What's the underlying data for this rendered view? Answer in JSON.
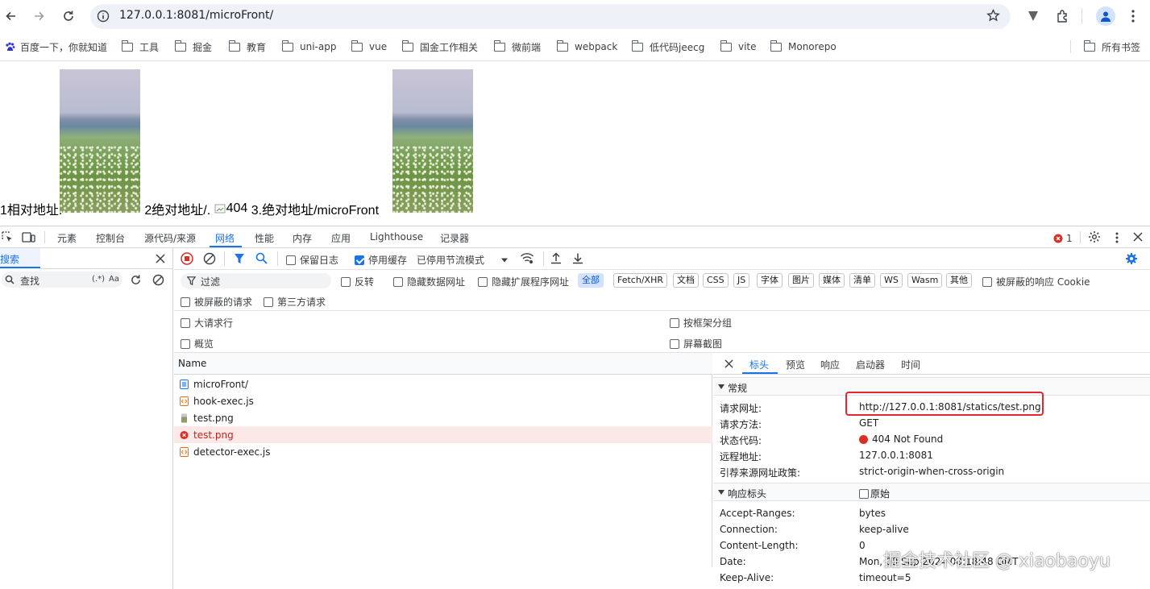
{
  "browser": {
    "url": "127.0.0.1:8081/microFront/",
    "bookmarks": [
      "百度一下，你就知道",
      "工具",
      "掘金",
      "教育",
      "uni-app",
      "vue",
      "国金工作相关",
      "微前端",
      "webpack",
      "低代码jeecg",
      "vite",
      "Monorepo"
    ],
    "all_bookmarks_label": "所有书签"
  },
  "page": {
    "text1": "1相对地址.",
    "text2": "2绝对地址/.",
    "broken_img_alt": "404",
    "text3": "3.绝对地址/microFront"
  },
  "devtools": {
    "tabs": [
      "元素",
      "控制台",
      "源代码/来源",
      "网络",
      "性能",
      "内存",
      "应用",
      "Lighthouse",
      "记录器"
    ],
    "active_tab": "网络",
    "error_count": "1",
    "left_panel": {
      "title": "搜索",
      "search_placeholder": "查找",
      "regex_label": "(.*)",
      "case_label": "Aa"
    },
    "toolbar": {
      "preserve_log": "保留日志",
      "disable_cache": "停用缓存",
      "throttle": "已停用节流模式"
    },
    "filter": {
      "placeholder": "过滤",
      "invert": "反转",
      "hide_data_urls": "隐藏数据网址",
      "hide_extension_urls": "隐藏扩展程序网址",
      "types": [
        "全部",
        "Fetch/XHR",
        "文档",
        "CSS",
        "JS",
        "字体",
        "图片",
        "媒体",
        "清单",
        "WS",
        "Wasm",
        "其他"
      ],
      "active_type": "全部",
      "blocked_cookies": "被屏蔽的响应 Cookie",
      "blocked_requests": "被屏蔽的请求",
      "third_party": "第三方请求"
    },
    "options": {
      "big_rows": "大请求行",
      "group_by_frame": "按框架分组",
      "overview": "概览",
      "screenshots": "屏幕截图"
    },
    "requests": {
      "header": "Name",
      "rows": [
        {
          "name": "microFront/",
          "kind": "doc"
        },
        {
          "name": "hook-exec.js",
          "kind": "script"
        },
        {
          "name": "test.png",
          "kind": "image"
        },
        {
          "name": "test.png",
          "kind": "error"
        },
        {
          "name": "detector-exec.js",
          "kind": "script"
        }
      ]
    },
    "detail": {
      "tabs": [
        "标头",
        "预览",
        "响应",
        "启动器",
        "时间"
      ],
      "active_tab": "标头",
      "general": {
        "title": "常规",
        "rows": [
          {
            "label": "请求网址:",
            "value": "http://127.0.0.1:8081/statics/test.png"
          },
          {
            "label": "请求方法:",
            "value": "GET"
          },
          {
            "label": "状态代码:",
            "value": "404 Not Found"
          },
          {
            "label": "远程地址:",
            "value": "127.0.0.1:8081"
          },
          {
            "label": "引荐来源网址政策:",
            "value": "strict-origin-when-cross-origin"
          }
        ]
      },
      "response_headers": {
        "title": "响应标头",
        "raw_label": "原始",
        "rows": [
          {
            "label": "Accept-Ranges:",
            "value": "bytes"
          },
          {
            "label": "Connection:",
            "value": "keep-alive"
          },
          {
            "label": "Content-Length:",
            "value": "0"
          },
          {
            "label": "Date:",
            "value": "Mon, 09 Sep 2024 08:18:48 GMT"
          },
          {
            "label": "Keep-Alive:",
            "value": "timeout=5"
          }
        ]
      }
    }
  },
  "watermark": "掘金技术社区 @ xiaobaoyu",
  "colors": {
    "accent": "#1a73e8",
    "error": "#d93025",
    "highlight_box": "#e3262f"
  }
}
